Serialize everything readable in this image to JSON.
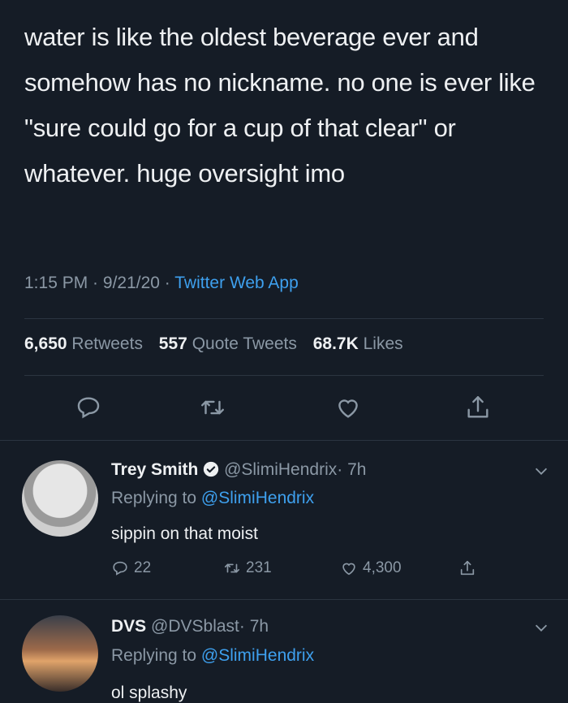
{
  "tweet": {
    "text": "water is like the oldest beverage ever and somehow has no nickname. no one is ever like \"sure could go for a cup of that clear\" or whatever. huge oversight imo",
    "time": "1:15 PM",
    "sep1": " · ",
    "date": "9/21/20",
    "sep2": " · ",
    "app": "Twitter Web App"
  },
  "stats": {
    "retweets_count": "6,650",
    "retweets_label": "Retweets",
    "quotes_count": "557",
    "quotes_label": "Quote Tweets",
    "likes_count": "68.7K",
    "likes_label": "Likes"
  },
  "replies": [
    {
      "name": "Trey Smith",
      "handle": "@SlimiHendrix",
      "time": "· 7h",
      "replying_label": "Replying to",
      "replying_to": "@SlimiHendrix",
      "text": "sippin on that moist",
      "replies": "22",
      "retweets": "231",
      "likes": "4,300"
    },
    {
      "name": "DVS",
      "handle": "@DVSblast",
      "time": "· 7h",
      "replying_label": "Replying to",
      "replying_to": "@SlimiHendrix",
      "text": "ol splashy"
    }
  ],
  "colors": {
    "background": "#151c26",
    "accent": "#3ea0ee",
    "muted": "#8b98a5"
  }
}
